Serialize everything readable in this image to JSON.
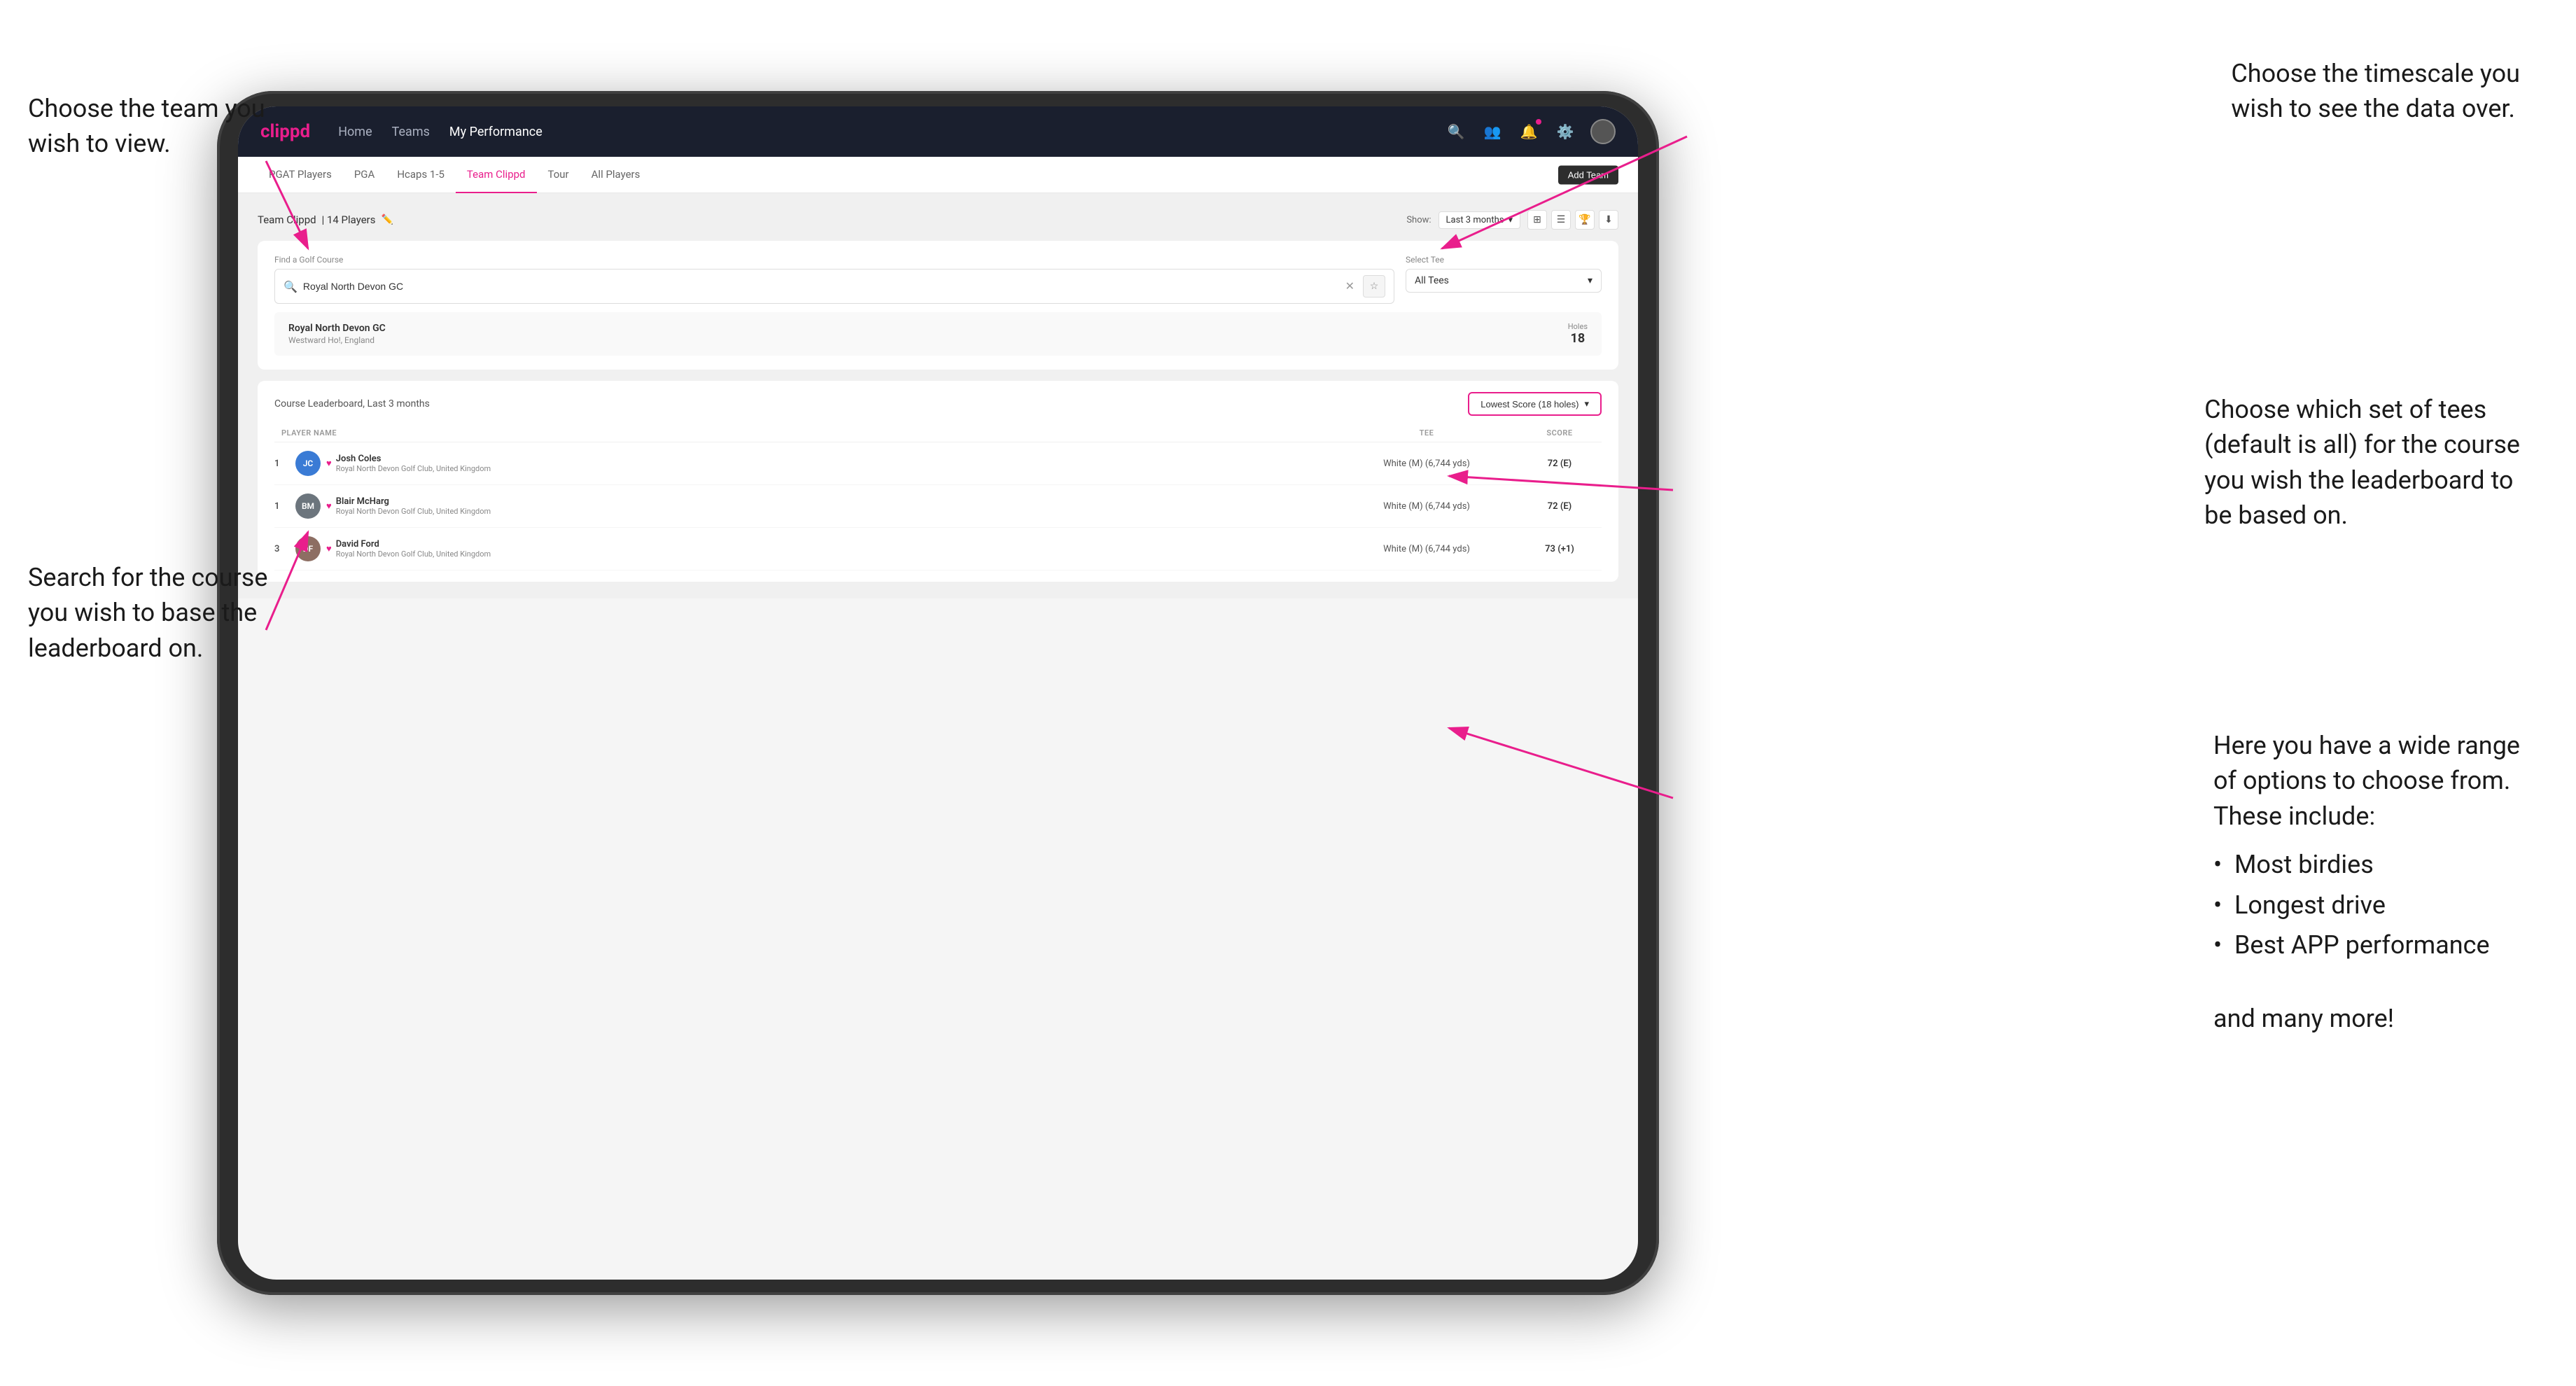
{
  "annotations": {
    "top_left_title": "Choose the team you",
    "top_left_subtitle": "wish to view.",
    "top_right_title": "Choose the timescale you",
    "top_right_subtitle": "wish to see the data over.",
    "middle_right_title": "Choose which set of tees",
    "middle_right_line2": "(default is all) for the course",
    "middle_right_line3": "you wish the leaderboard to",
    "middle_right_line4": "be based on.",
    "left_search_title": "Search for the course",
    "left_search_line2": "you wish to base the",
    "left_search_line3": "leaderboard on.",
    "right_options_title": "Here you have a wide range",
    "right_options_line2": "of options to choose from.",
    "right_options_line3": "These include:",
    "bullet1": "Most birdies",
    "bullet2": "Longest drive",
    "bullet3": "Best APP performance",
    "and_more": "and many more!"
  },
  "navbar": {
    "logo": "clippd",
    "links": [
      "Home",
      "Teams",
      "My Performance"
    ],
    "active_link": "My Performance"
  },
  "sub_nav": {
    "tabs": [
      "PGAT Players",
      "PGA",
      "Hcaps 1-5",
      "Team Clippd",
      "Tour",
      "All Players"
    ],
    "active_tab": "Team Clippd",
    "add_team_label": "Add Team"
  },
  "team_header": {
    "title": "Team Clippd",
    "player_count": "14 Players",
    "show_label": "Show:",
    "show_value": "Last 3 months"
  },
  "search": {
    "find_label": "Find a Golf Course",
    "placeholder": "Royal North Devon GC",
    "select_tee_label": "Select Tee",
    "tee_value": "All Tees"
  },
  "course_result": {
    "name": "Royal North Devon GC",
    "location": "Westward Ho!, England",
    "holes_label": "Holes",
    "holes_num": "18"
  },
  "leaderboard": {
    "title": "Course Leaderboard,",
    "period": "Last 3 months",
    "score_type": "Lowest Score (18 holes)",
    "columns": [
      "PLAYER NAME",
      "TEE",
      "SCORE"
    ],
    "players": [
      {
        "rank": "1",
        "name": "Josh Coles",
        "club": "Royal North Devon Golf Club, United Kingdom",
        "tee": "White (M) (6,744 yds)",
        "score": "72 (E)",
        "initials": "JC",
        "color_class": "jc"
      },
      {
        "rank": "1",
        "name": "Blair McHarg",
        "club": "Royal North Devon Golf Club, United Kingdom",
        "tee": "White (M) (6,744 yds)",
        "score": "72 (E)",
        "initials": "BM",
        "color_class": "bm"
      },
      {
        "rank": "3",
        "name": "David Ford",
        "club": "Royal North Devon Golf Club, United Kingdom",
        "tee": "White (M) (6,744 yds)",
        "score": "73 (+1)",
        "initials": "DF",
        "color_class": "df"
      }
    ]
  }
}
